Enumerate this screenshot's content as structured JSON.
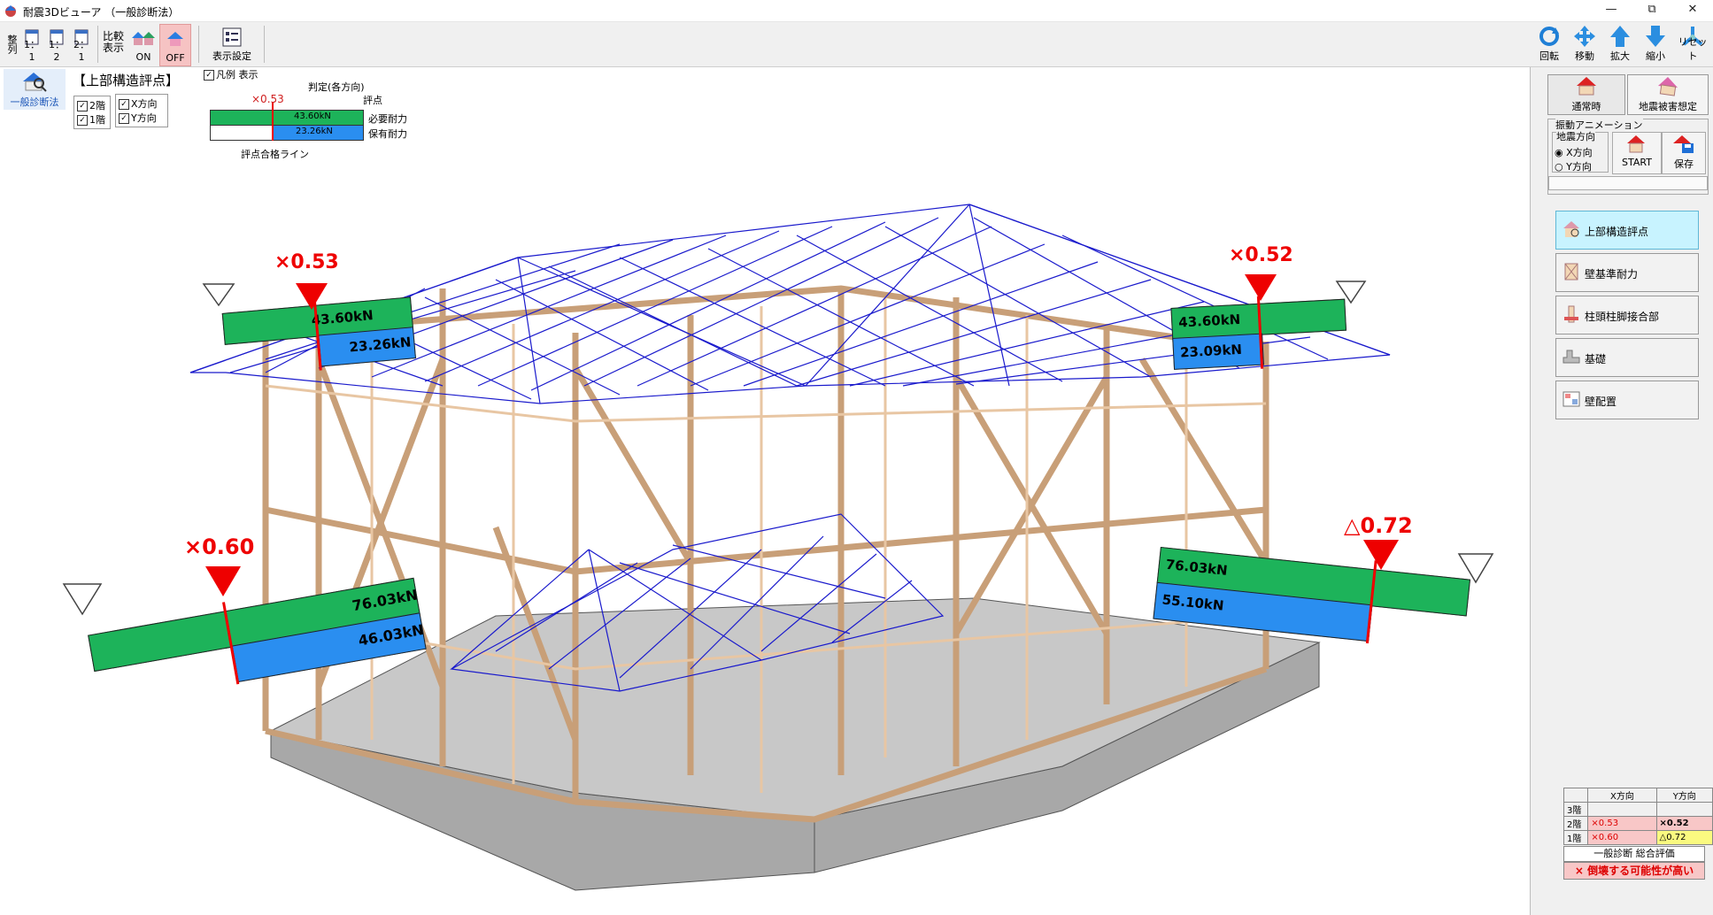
{
  "window": {
    "title": "耐震3Dビューア （一般診断法）",
    "minimize": "—",
    "maximize": "⧉",
    "close": "✕"
  },
  "toolbar": {
    "arrange_label": "整列",
    "layout_1_1": "1：1",
    "layout_1_2": "1：2",
    "layout_2_1": "2：1",
    "compare_label": "比較表示",
    "on_label": "ON",
    "off_label": "OFF",
    "display_settings": "表示設定",
    "rotate": "回転",
    "move": "移動",
    "zoom_in": "拡大",
    "zoom_out": "縮小",
    "reset": "リセット"
  },
  "left": {
    "method_label": "一般診断法",
    "section_title": "【上部構造評点】",
    "legend_checkbox": "凡例 表示",
    "floor2": "2階",
    "floor1": "1階",
    "dir_x": "X方向",
    "dir_y": "Y方向"
  },
  "legend": {
    "judgement": "判定(各方向)",
    "score_mark": "×0.53",
    "score": "評点",
    "required_value": "43.60kN",
    "required_label": "必要耐力",
    "held_value": "23.26kN",
    "held_label": "保有耐力",
    "pass_line": "評点合格ライン"
  },
  "indicators": [
    {
      "id": "2f-left",
      "score": "×0.53",
      "required": "43.60kN",
      "held": "23.26kN",
      "ratio": 0.53
    },
    {
      "id": "2f-right",
      "score": "×0.52",
      "required": "43.60kN",
      "held": "23.09kN",
      "ratio": 0.52
    },
    {
      "id": "1f-left",
      "score": "×0.60",
      "required": "76.03kN",
      "held": "46.03kN",
      "ratio": 0.6
    },
    {
      "id": "1f-right",
      "score": "△0.72",
      "required": "76.03kN",
      "held": "55.10kN",
      "ratio": 0.72
    }
  ],
  "right": {
    "normal_btn": "通常時",
    "damage_btn": "地震被害想定",
    "vibration_group": "振動アニメーション",
    "quake_dir": "地震方向",
    "radio_x": "X方向",
    "radio_y": "Y方向",
    "start": "START",
    "save": "保存",
    "nav": [
      "上部構造評点",
      "壁基準耐力",
      "柱頭柱脚接合部",
      "基礎",
      "壁配置"
    ],
    "table": {
      "head": [
        "",
        "X方向",
        "Y方向"
      ],
      "rows": [
        [
          "3階",
          "",
          ""
        ],
        [
          "2階",
          "×0.53",
          "×0.52"
        ],
        [
          "1階",
          "×0.60",
          "△0.72"
        ]
      ]
    },
    "overall_title": "一般診断 総合評価",
    "overall_result": "× 倒壊する可能性が高い"
  },
  "colors": {
    "green": "#1db35a",
    "blue": "#2a8ef0",
    "red": "#ff0000",
    "wood": "#f0c9a4",
    "roof": "#1a1acc"
  }
}
